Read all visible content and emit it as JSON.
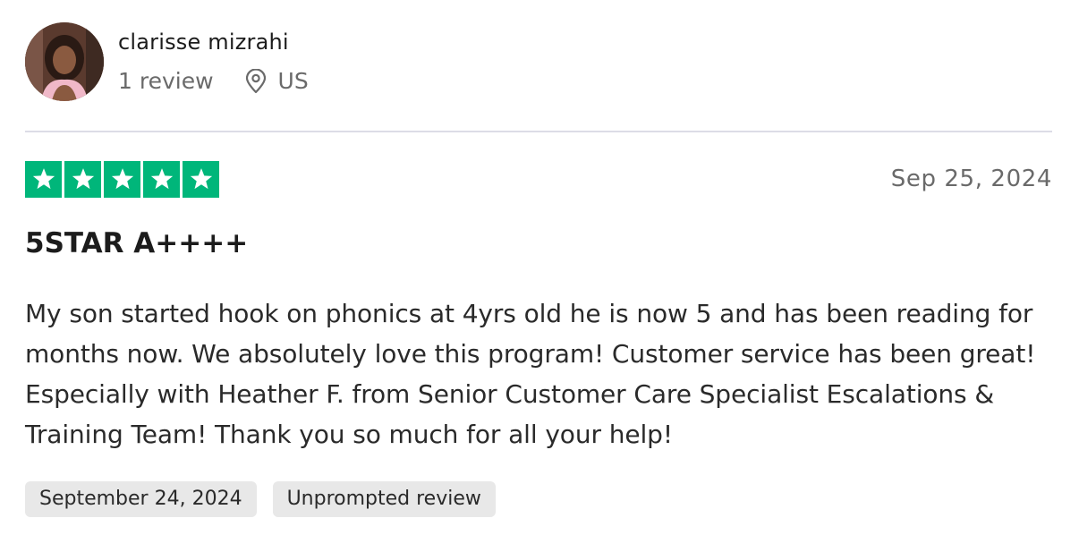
{
  "reviewer": {
    "name": "clarisse mizrahi",
    "review_count": "1 review",
    "location": "US",
    "avatar_icon": "user-photo"
  },
  "review": {
    "rating": 5,
    "rating_max": 5,
    "star_color": "#00b67a",
    "date": "Sep 25, 2024",
    "title": "5STAR A++++",
    "body": "My son started hook on phonics at 4yrs old he is now 5 and has been reading for months now. We absolutely love this program! Customer service has been great! Especially with Heather F. from Senior Customer Care Specialist Escalations & Training Team! Thank you so much for all your help!",
    "experience_date": "September 24, 2024",
    "review_type": "Unprompted review"
  },
  "icons": {
    "location": "location-pin-icon",
    "star": "star-icon"
  }
}
